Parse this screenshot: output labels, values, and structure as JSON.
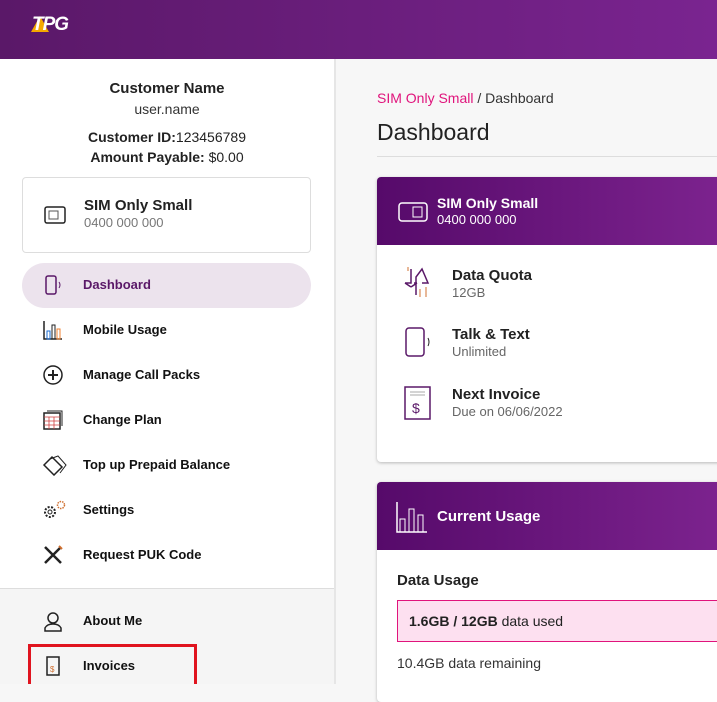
{
  "brand": {
    "logo": "TPG",
    "accent": "#e0147c",
    "purple": "#6a1b7e"
  },
  "customer": {
    "name": "Customer Name",
    "username": "user.name",
    "id_label": "Customer ID:",
    "id": "123456789",
    "amount_label": "Amount Payable:",
    "amount": "$0.00"
  },
  "sim": {
    "plan": "SIM Only Small",
    "number": "0400 000 000"
  },
  "nav": [
    {
      "label": "Dashboard",
      "icon": "phone-icon",
      "active": true
    },
    {
      "label": "Mobile Usage",
      "icon": "bar-chart-icon"
    },
    {
      "label": "Manage Call Packs",
      "icon": "plus-circle-icon"
    },
    {
      "label": "Change Plan",
      "icon": "calendar-icon"
    },
    {
      "label": "Top up Prepaid Balance",
      "icon": "cards-icon"
    },
    {
      "label": "Settings",
      "icon": "gears-icon"
    },
    {
      "label": "Request PUK Code",
      "icon": "tools-icon"
    }
  ],
  "nav_bottom": [
    {
      "label": "About Me",
      "icon": "user-icon"
    },
    {
      "label": "Invoices",
      "icon": "invoice-icon"
    }
  ],
  "breadcrumb": {
    "link": "SIM Only Small",
    "separator": "/",
    "current": "Dashboard"
  },
  "page_title": "Dashboard",
  "plan_card": {
    "title": "SIM Only Small",
    "number": "0400 000 000",
    "rows": [
      {
        "title": "Data Quota",
        "value": "12GB"
      },
      {
        "title": "Talk & Text",
        "value": "Unlimited"
      },
      {
        "title": "Next Invoice",
        "value": "Due on 06/06/2022"
      }
    ]
  },
  "usage_card": {
    "title": "Current Usage",
    "section": "Data Usage",
    "used": "1.6GB / 12GB",
    "used_suffix": "data used",
    "remaining": "10.4GB data remaining"
  }
}
